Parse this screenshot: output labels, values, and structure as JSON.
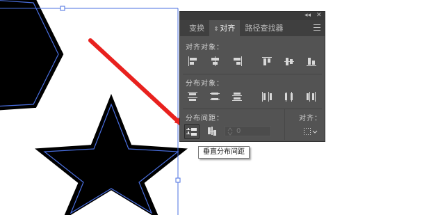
{
  "panel": {
    "title_bar": {
      "collapse": "◂◂",
      "close": "✕"
    },
    "tabs": [
      {
        "label": "变换",
        "active": false
      },
      {
        "label": "对齐",
        "active": true
      },
      {
        "label": "路径查找器",
        "active": false
      }
    ],
    "sections": {
      "align_objects": "对齐对象：",
      "distribute_objects": "分布对象：",
      "distribute_spacing": "分布间距：",
      "align_to": "对齐："
    },
    "spacing_value": "0",
    "tooltip": "垂直分布间距"
  },
  "colors": {
    "panel_bg": "#535353",
    "selection_blue": "#4a6fe0",
    "arrow_red": "#e8211e",
    "shape_fill": "#000000"
  }
}
